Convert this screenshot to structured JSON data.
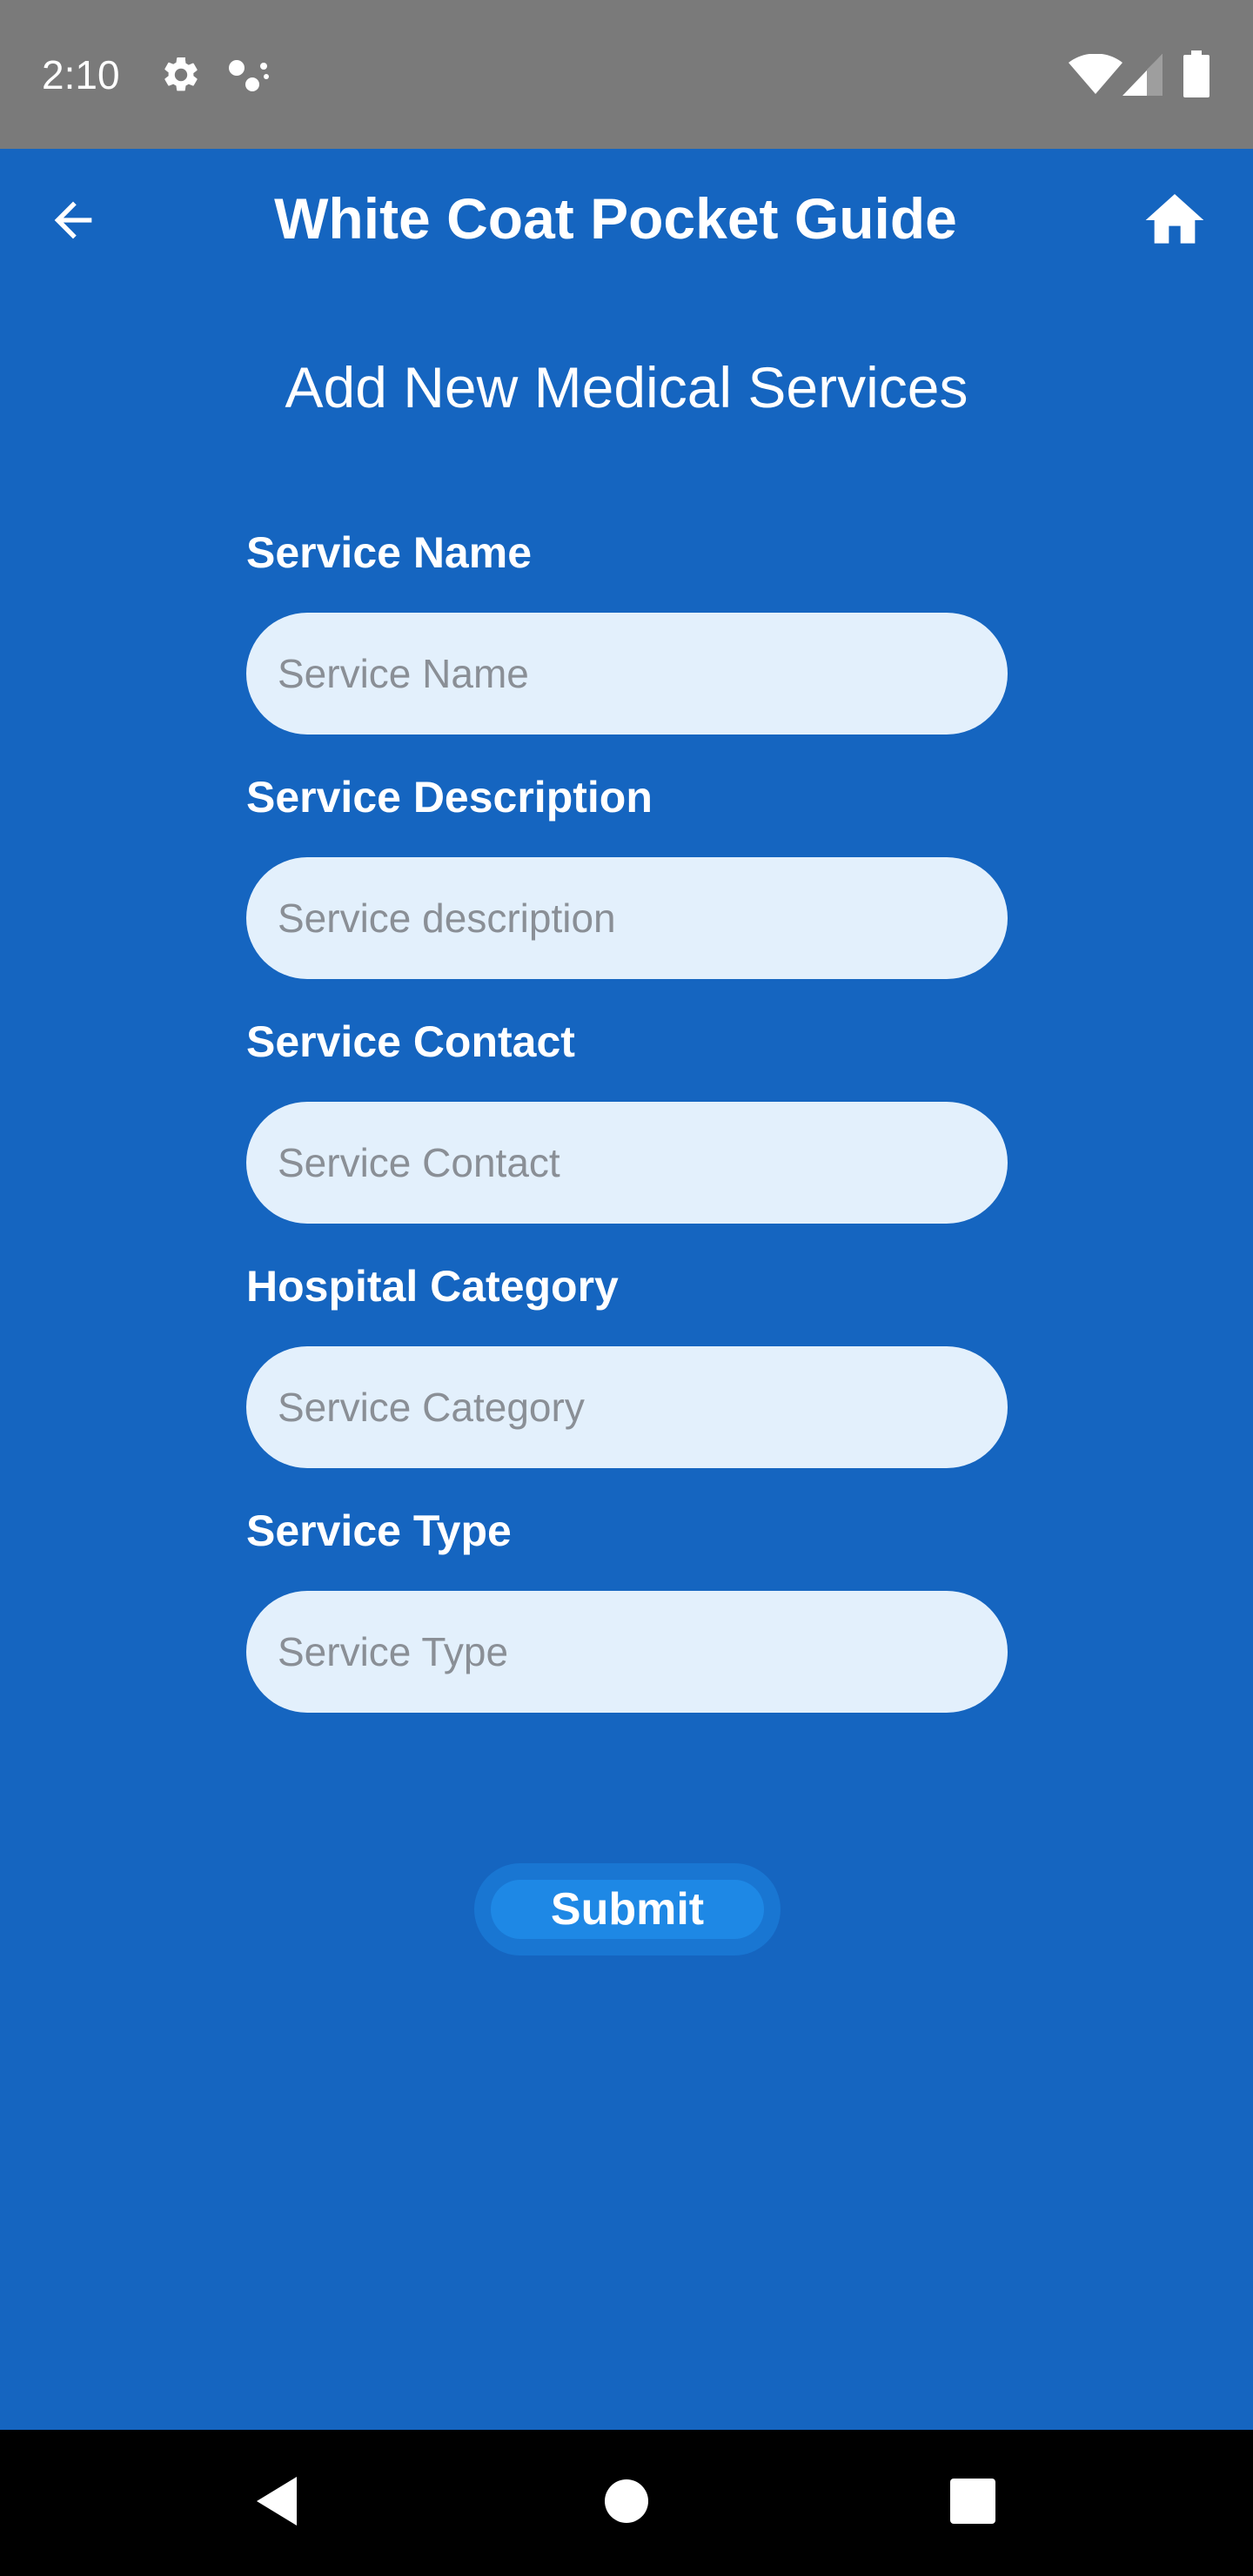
{
  "status_bar": {
    "time": "2:10",
    "icons": [
      "settings-icon",
      "assistant-dots-icon",
      "wifi-icon",
      "cell-signal-icon",
      "battery-icon"
    ]
  },
  "app_bar": {
    "title": "White Coat Pocket Guide",
    "back_icon": "arrow-left-icon",
    "home_icon": "home-icon"
  },
  "page": {
    "heading": "Add New Medical Services"
  },
  "form": {
    "fields": [
      {
        "label": "Service Name",
        "value": "",
        "placeholder": "Service Name"
      },
      {
        "label": "Service Description",
        "value": "",
        "placeholder": "Service description"
      },
      {
        "label": "Service Contact",
        "value": "",
        "placeholder": "Service Contact"
      },
      {
        "label": "Hospital Category",
        "value": "",
        "placeholder": "Service Category"
      },
      {
        "label": "Service Type",
        "value": "",
        "placeholder": "Service Type"
      }
    ],
    "submit_label": "Submit"
  },
  "nav_bar": {
    "icons": [
      "back-triangle-icon",
      "home-circle-icon",
      "recents-square-icon"
    ]
  },
  "colors": {
    "background": "#1565C0",
    "status_bar": "#7A7A7A",
    "input_fill": "#E3F0FC",
    "submit_fill": "#1E88E5",
    "nav_bar": "#000000"
  }
}
